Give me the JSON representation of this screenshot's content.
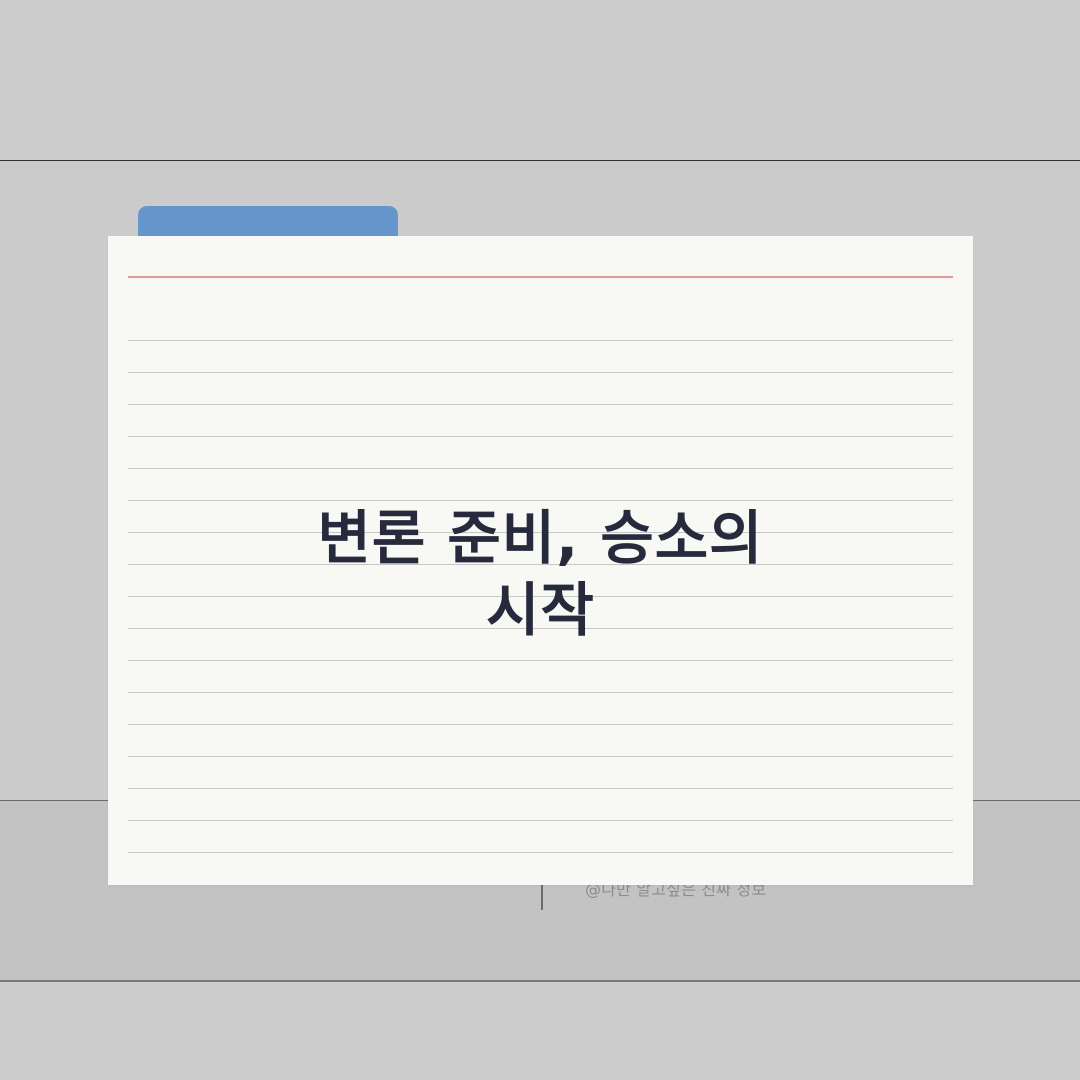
{
  "card": {
    "title_lines": [
      "변론 준비, 승소의",
      "시작"
    ]
  },
  "footer": {
    "credit": "@나만 알고싶은 진짜 정보"
  },
  "colors": {
    "background": "#cccccc",
    "card": "#f8f8f5",
    "folder_tab": "#6595ca",
    "margin_line": "#dd9a96",
    "title_text": "#262a3c"
  }
}
